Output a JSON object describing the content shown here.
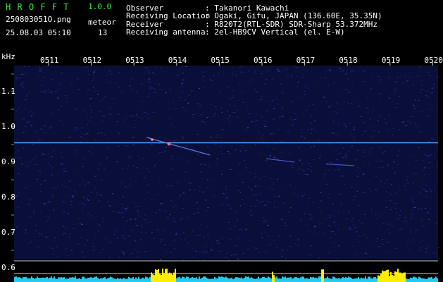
{
  "header": {
    "logo_text": "H R O F F T",
    "version": "1.0.0",
    "filename": "250803051O.png",
    "meteor_label": "meteor",
    "meteor_count": "13",
    "datetime": "25.08.03 05:10"
  },
  "station_info": {
    "observer_label": "Observer",
    "observer_value": ": Takanori Kawachi",
    "location_label": "Receiving Location",
    "location_value": ": Ogaki, Gifu, JAPAN (136.60E, 35.35N)",
    "receiver_label": "Receiver",
    "receiver_value": ": R820T2(RTL-SDR) SDR-Sharp 53.372MHz",
    "antenna_label": "Receiving antenna",
    "antenna_value": ": 2el-HB9CV Vertical (el. E-W)"
  },
  "axes": {
    "y_unit": "kHz",
    "y_ticks": [
      "1.1",
      "1.0",
      "0.9",
      "0.8",
      "0.7",
      "0.6"
    ],
    "x_ticks": [
      "0511",
      "0512",
      "0513",
      "0514",
      "0515",
      "0516",
      "0517",
      "0518",
      "0519",
      "0520"
    ]
  },
  "colors": {
    "background": "#000000",
    "noise": "#1a2a7a",
    "carrier": "#3fa0ff",
    "meteor": "#ff6699",
    "level": "#22ccee",
    "level_peak": "#ffee00",
    "text_green": "#33ee33",
    "text_white": "#ffffff"
  },
  "chart_data": {
    "type": "heatmap",
    "x_range_minutes": [
      "05:10",
      "05:20"
    ],
    "y_range_khz": [
      0.6,
      1.15
    ],
    "carrier_khz": 0.955,
    "meteor_events": [
      {
        "time": "0513.3",
        "freq_start_khz": 0.97,
        "freq_end_khz": 0.92
      },
      {
        "time": "0516.1",
        "freq_start_khz": 0.91,
        "freq_end_khz": 0.9
      },
      {
        "time": "0517.5",
        "freq_start_khz": 0.895,
        "freq_end_khz": 0.89
      }
    ]
  }
}
